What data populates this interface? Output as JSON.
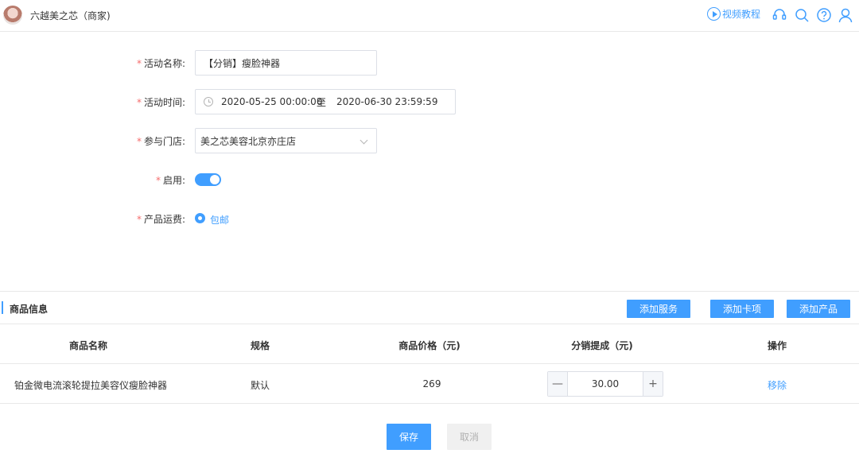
{
  "header": {
    "store_name": "六越美之芯（商家)",
    "video_tutorial": "视频教程",
    "icons": [
      "headset-icon",
      "search-icon",
      "help-icon",
      "user-icon"
    ]
  },
  "form": {
    "activity_name": {
      "label": "活动名称:",
      "value": "【分销】瘦脸神器"
    },
    "activity_time": {
      "label": "活动时间:",
      "start": "2020-05-25 00:00:00",
      "separator": "至",
      "end": "2020-06-30 23:59:59"
    },
    "store": {
      "label": "参与门店:",
      "value": "美之芯美容北京亦庄店"
    },
    "enabled": {
      "label": "启用:",
      "on": true
    },
    "shipping": {
      "label": "产品运费:",
      "option": "包邮"
    },
    "required_mark": "*"
  },
  "goods": {
    "title": "商品信息",
    "buttons": {
      "add_service": "添加服务",
      "add_card": "添加卡项",
      "add_product": "添加产品"
    },
    "columns": [
      "商品名称",
      "规格",
      "商品价格（元)",
      "分销提成（元)",
      "操作"
    ],
    "rows": [
      {
        "name": "铂金微电流滚轮提拉美容仪瘦脸神器",
        "spec": "默认",
        "price": "269",
        "commission": "30.00",
        "action": "移除"
      }
    ],
    "stepper": {
      "minus": "—",
      "plus": "+"
    }
  },
  "footer": {
    "save": "保存",
    "cancel": "取消"
  },
  "colors": {
    "accent": "#409eff",
    "required": "#f56c6c"
  }
}
